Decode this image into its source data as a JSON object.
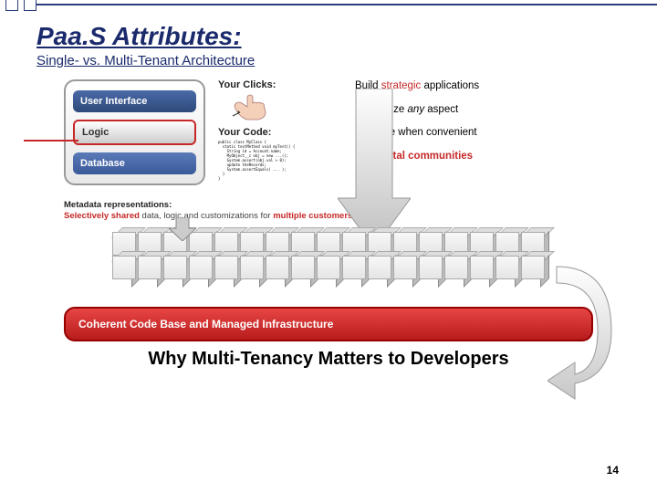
{
  "title": "Paa.S Attributes:",
  "subtitle": "Single- vs. Multi-Tenant Architecture",
  "stack": {
    "ui": "User Interface",
    "logic": "Logic",
    "db": "Database"
  },
  "clicks": {
    "label": "Your Clicks:"
  },
  "code": {
    "label": "Your Code:",
    "content": "public class MyClass {\n  static testMethod void myTest() {\n    String id = Account.name;\n    MyObject__c obj = new ...();\n    System.assert(obj.val > 0);\n    update theRecords;\n    System.assertEquals( ... );\n  }\n}"
  },
  "bullets": {
    "b1a": "Build ",
    "b1b": "strategic",
    "b1c": " applications",
    "b2a": "Customize ",
    "b2b": "any",
    "b2c": " aspect",
    "b3": "Upgrade when convenient",
    "b4": "Build vital communities"
  },
  "metadata": {
    "l1": "Metadata representations:",
    "l2": "Selectively shared",
    "l3": " data, logic and customizations for "
  },
  "metadata_l3b": "multiple customers",
  "red_bar": "Coherent Code Base and Managed Infrastructure",
  "bottom_caption": "Why Multi-Tenancy Matters to Developers",
  "page_number": "14"
}
